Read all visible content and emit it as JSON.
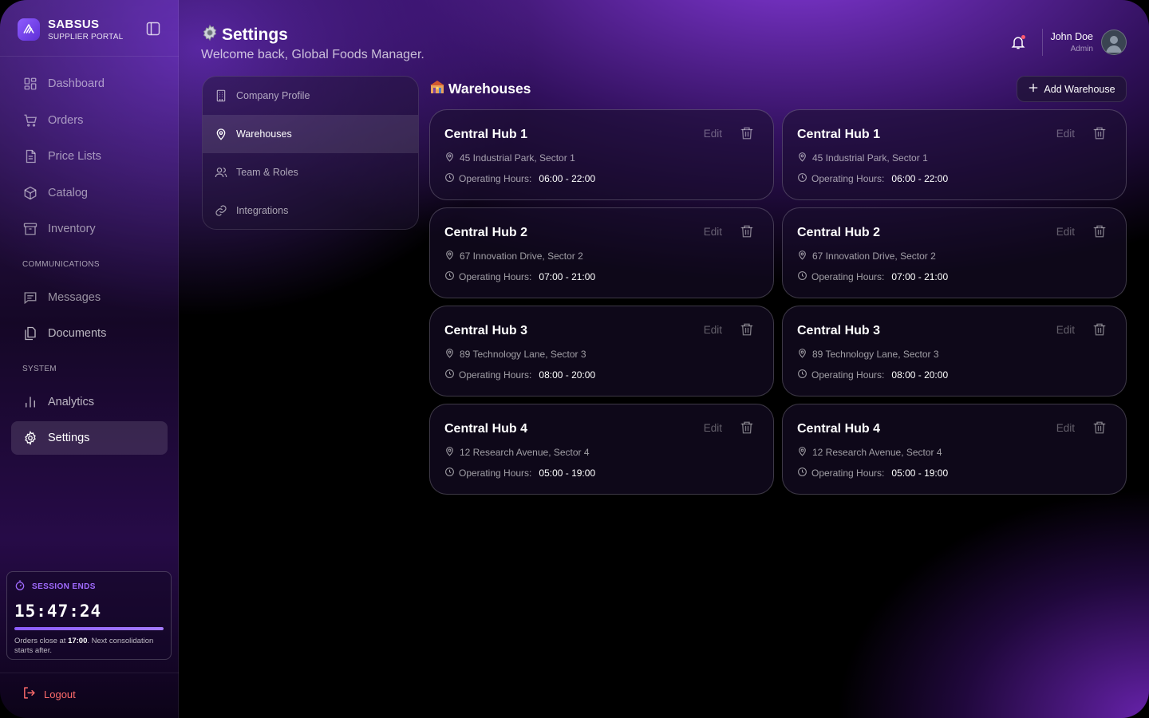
{
  "brand": {
    "name": "SABSUS",
    "subtitle": "SUPPLIER PORTAL"
  },
  "sidebar": {
    "items": [
      {
        "label": "Dashboard",
        "icon": "grid-icon"
      },
      {
        "label": "Orders",
        "icon": "cart-icon"
      },
      {
        "label": "Price Lists",
        "icon": "document-icon"
      },
      {
        "label": "Catalog",
        "icon": "box-icon"
      },
      {
        "label": "Inventory",
        "icon": "archive-icon"
      }
    ],
    "sections": {
      "communications": "COMMUNICATIONS",
      "system": "SYSTEM"
    },
    "comm_items": [
      {
        "label": "Messages",
        "icon": "message-icon"
      },
      {
        "label": "Documents",
        "icon": "files-icon"
      }
    ],
    "system_items": [
      {
        "label": "Analytics",
        "icon": "bar-chart-icon"
      },
      {
        "label": "Settings",
        "icon": "gear-icon",
        "active": true
      }
    ],
    "session": {
      "label": "SESSION ENDS",
      "time": "15:47:24",
      "progress": 1.0,
      "note_prefix": "Orders close at ",
      "note_time": "17:00",
      "note_suffix": ". Next consolidation starts after."
    },
    "logout_label": "Logout"
  },
  "header": {
    "title": "Settings",
    "subtitle": "Welcome back, Global Foods Manager.",
    "user": {
      "name": "John Doe",
      "role": "Admin"
    }
  },
  "settings_menu": [
    {
      "label": "Company Profile",
      "icon": "building-icon"
    },
    {
      "label": "Warehouses",
      "icon": "map-pin-icon",
      "active": true
    },
    {
      "label": "Team & Roles",
      "icon": "users-icon"
    },
    {
      "label": "Integrations",
      "icon": "link-icon"
    }
  ],
  "warehouses": {
    "title": "Warehouses",
    "add_label": "Add Warehouse",
    "edit_label": "Edit",
    "hours_label": "Operating Hours:",
    "cards": [
      {
        "name": "Central Hub 1",
        "address": "45 Industrial Park, Sector 1",
        "hours": "06:00 - 22:00"
      },
      {
        "name": "Central Hub 1",
        "address": "45 Industrial Park, Sector 1",
        "hours": "06:00 - 22:00"
      },
      {
        "name": "Central Hub 2",
        "address": "67 Innovation Drive, Sector 2",
        "hours": "07:00 - 21:00"
      },
      {
        "name": "Central Hub 2",
        "address": "67 Innovation Drive, Sector 2",
        "hours": "07:00 - 21:00"
      },
      {
        "name": "Central Hub 3",
        "address": "89 Technology Lane, Sector 3",
        "hours": "08:00 - 20:00"
      },
      {
        "name": "Central Hub 3",
        "address": "89 Technology Lane, Sector 3",
        "hours": "08:00 - 20:00"
      },
      {
        "name": "Central Hub 4",
        "address": "12 Research Avenue, Sector 4",
        "hours": "05:00 - 19:00"
      },
      {
        "name": "Central Hub 4",
        "address": "12 Research Avenue, Sector 4",
        "hours": "05:00 - 19:00"
      }
    ]
  },
  "colors": {
    "accent": "#8c5cff",
    "danger": "#ff6b6b",
    "notification": "#ff5a6e"
  }
}
